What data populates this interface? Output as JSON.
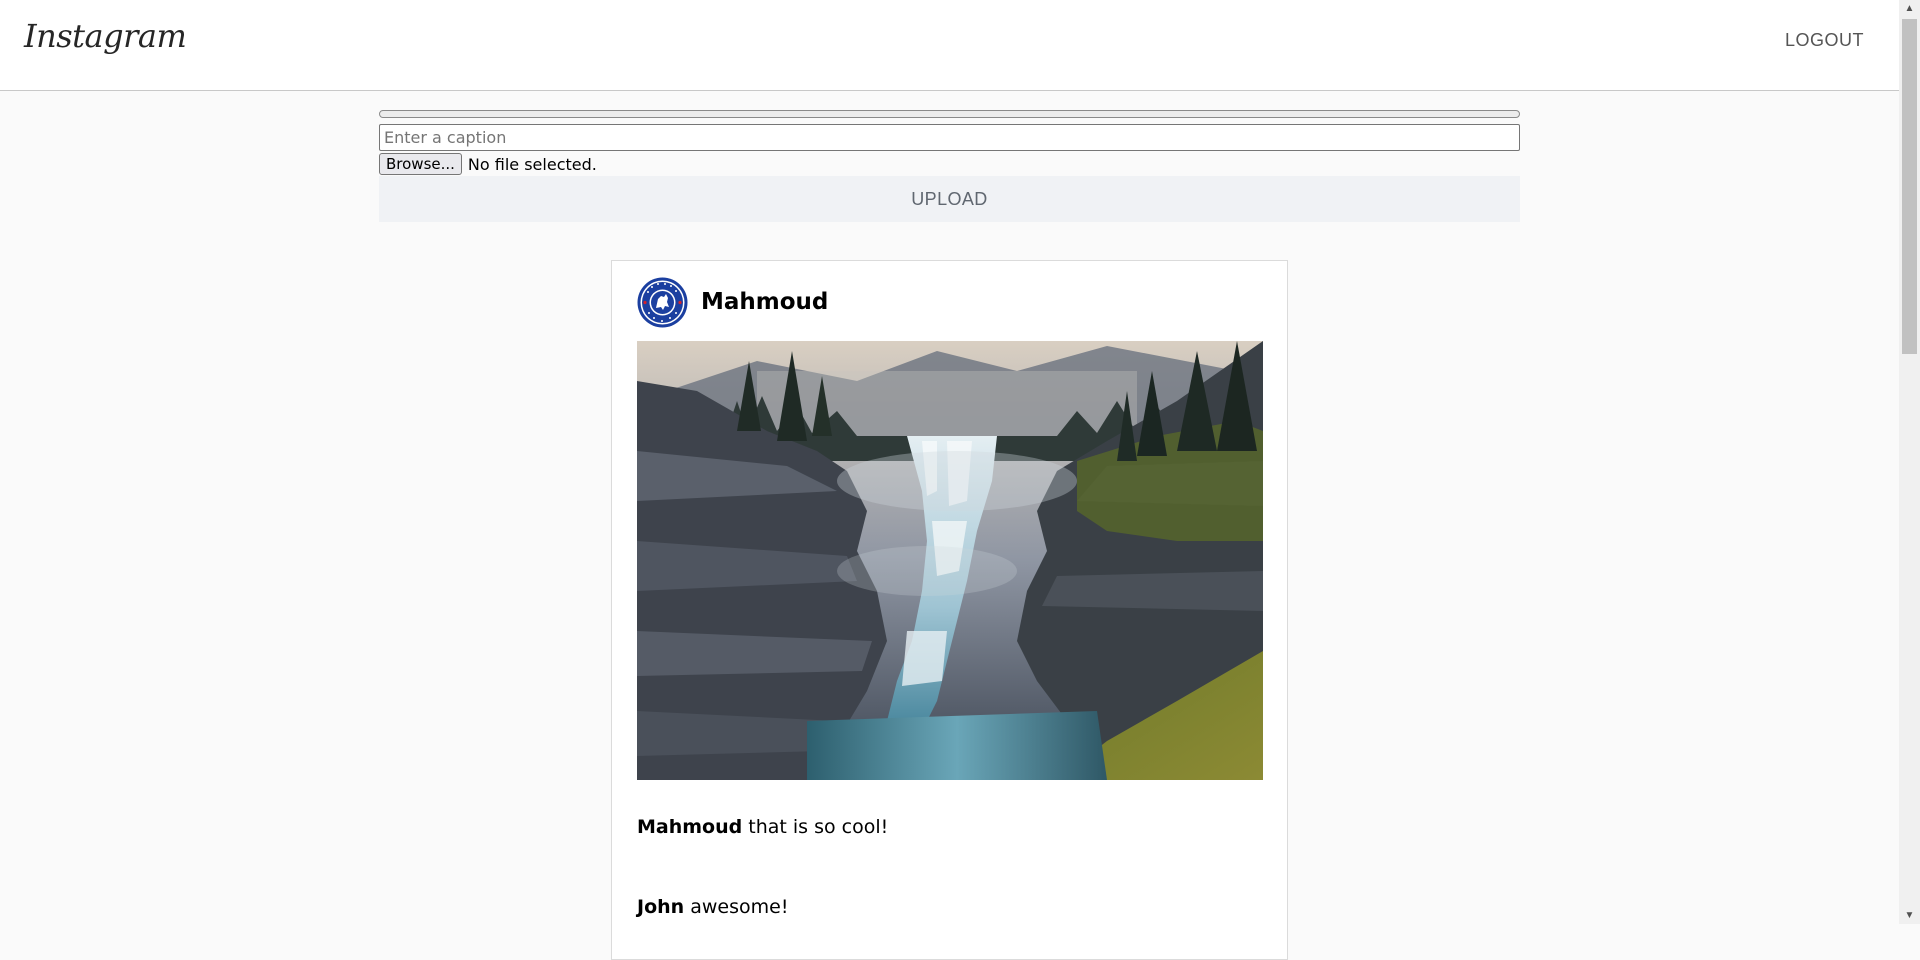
{
  "header": {
    "logo_text": "Instagram",
    "logout_label": "LOGOUT"
  },
  "upload": {
    "progress_value": 0,
    "caption_placeholder": "Enter a caption",
    "caption_value": "",
    "browse_label": "Browse...",
    "file_status": "No file selected.",
    "upload_label": "UPLOAD"
  },
  "post": {
    "username": "Mahmoud",
    "avatar": "chelsea-badge-icon",
    "image": "waterfall-canyon-photo",
    "comments": [
      {
        "user": "Mahmoud",
        "text": "that is so cool!"
      },
      {
        "user": "John",
        "text": "awesome!"
      }
    ]
  },
  "colors": {
    "background": "#fafafa",
    "card": "#ffffff",
    "upload_button_bg": "#f0f2f5",
    "text_muted": "#555555"
  }
}
